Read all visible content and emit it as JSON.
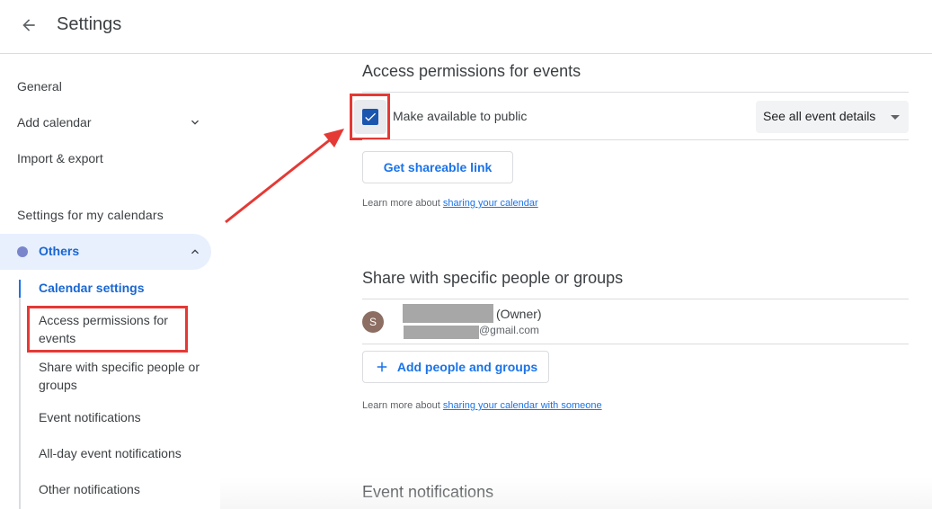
{
  "header": {
    "title": "Settings",
    "back_icon": "arrow-back-icon"
  },
  "sidebar": {
    "items": [
      {
        "label": "General"
      },
      {
        "label": "Add calendar",
        "icon": "chevron-down-icon"
      },
      {
        "label": "Import & export"
      }
    ],
    "section_title": "Settings for my calendars",
    "calendar": {
      "label": "Others",
      "dot_color": "#7986cb",
      "icon": "chevron-up-icon"
    },
    "sub_items": [
      {
        "label": "Calendar settings",
        "active": true
      },
      {
        "label": "Access permissions for events"
      },
      {
        "label": "Share with specific people or groups"
      },
      {
        "label": "Event notifications"
      },
      {
        "label": "All-day event notifications"
      },
      {
        "label": "Other notifications"
      }
    ]
  },
  "access": {
    "title": "Access permissions for events",
    "public_label": "Make available to public",
    "public_checked": true,
    "detail_select": "See all event details",
    "share_link_button": "Get shareable link",
    "learn_prefix": "Learn more about ",
    "learn_link": "sharing your calendar"
  },
  "share": {
    "title": "Share with specific people or groups",
    "owner": {
      "avatar_letter": "S",
      "role": "(Owner)",
      "email_suffix": "@gmail.com"
    },
    "add_button": "Add people and groups",
    "learn_prefix": "Learn more about ",
    "learn_link": "sharing your calendar with someone"
  },
  "notifications": {
    "title": "Event notifications"
  },
  "colors": {
    "accent": "#1a73e8",
    "highlight": "#e53935",
    "checkbox": "#1a56b0"
  }
}
